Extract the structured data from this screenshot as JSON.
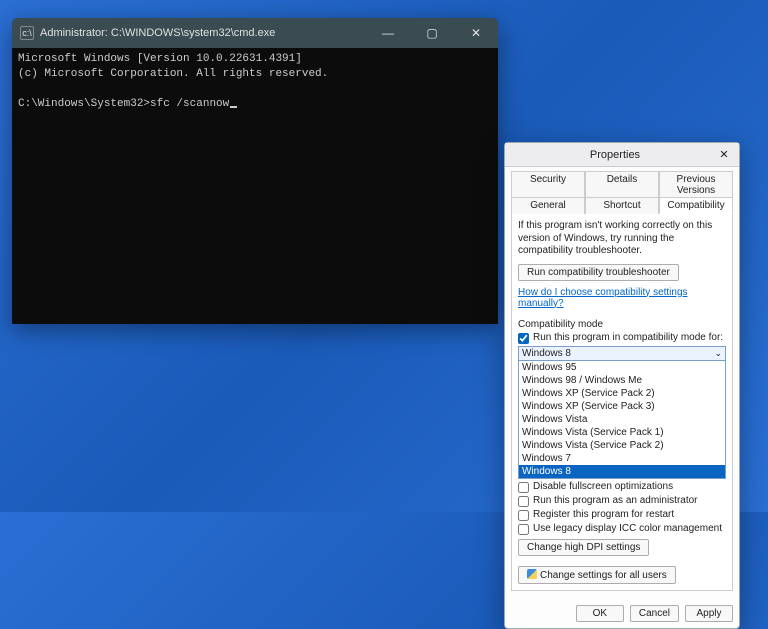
{
  "terminal": {
    "title": "Administrator: C:\\WINDOWS\\system32\\cmd.exe",
    "line1": "Microsoft Windows [Version 10.0.22631.4391]",
    "line2": "(c) Microsoft Corporation. All rights reserved.",
    "prompt": "C:\\Windows\\System32>",
    "command": "sfc /scannow"
  },
  "props": {
    "title": "Properties",
    "tabs_row1": [
      "Security",
      "Details",
      "Previous Versions"
    ],
    "tabs_row2": [
      "General",
      "Shortcut",
      "Compatibility"
    ],
    "active_tab": "Compatibility",
    "desc": "If this program isn't working correctly on this version of Windows, try running the compatibility troubleshooter.",
    "troubleshoot_btn": "Run compatibility troubleshooter",
    "help_link": "How do I choose compatibility settings manually?",
    "compat_mode_label": "Compatibility mode",
    "compat_mode_chk": "Run this program in compatibility mode for:",
    "combo_selected": "Windows 8",
    "dropdown": [
      "Windows 95",
      "Windows 98 / Windows Me",
      "Windows XP (Service Pack 2)",
      "Windows XP (Service Pack 3)",
      "Windows Vista",
      "Windows Vista (Service Pack 1)",
      "Windows Vista (Service Pack 2)",
      "Windows 7",
      "Windows 8"
    ],
    "disable_fullscreen": "Disable fullscreen optimizations",
    "run_admin": "Run this program as an administrator",
    "register_restart": "Register this program for restart",
    "legacy_icc": "Use legacy display ICC color management",
    "dpi_btn": "Change high DPI settings",
    "all_users_btn": "Change settings for all users",
    "ok": "OK",
    "cancel": "Cancel",
    "apply": "Apply"
  }
}
